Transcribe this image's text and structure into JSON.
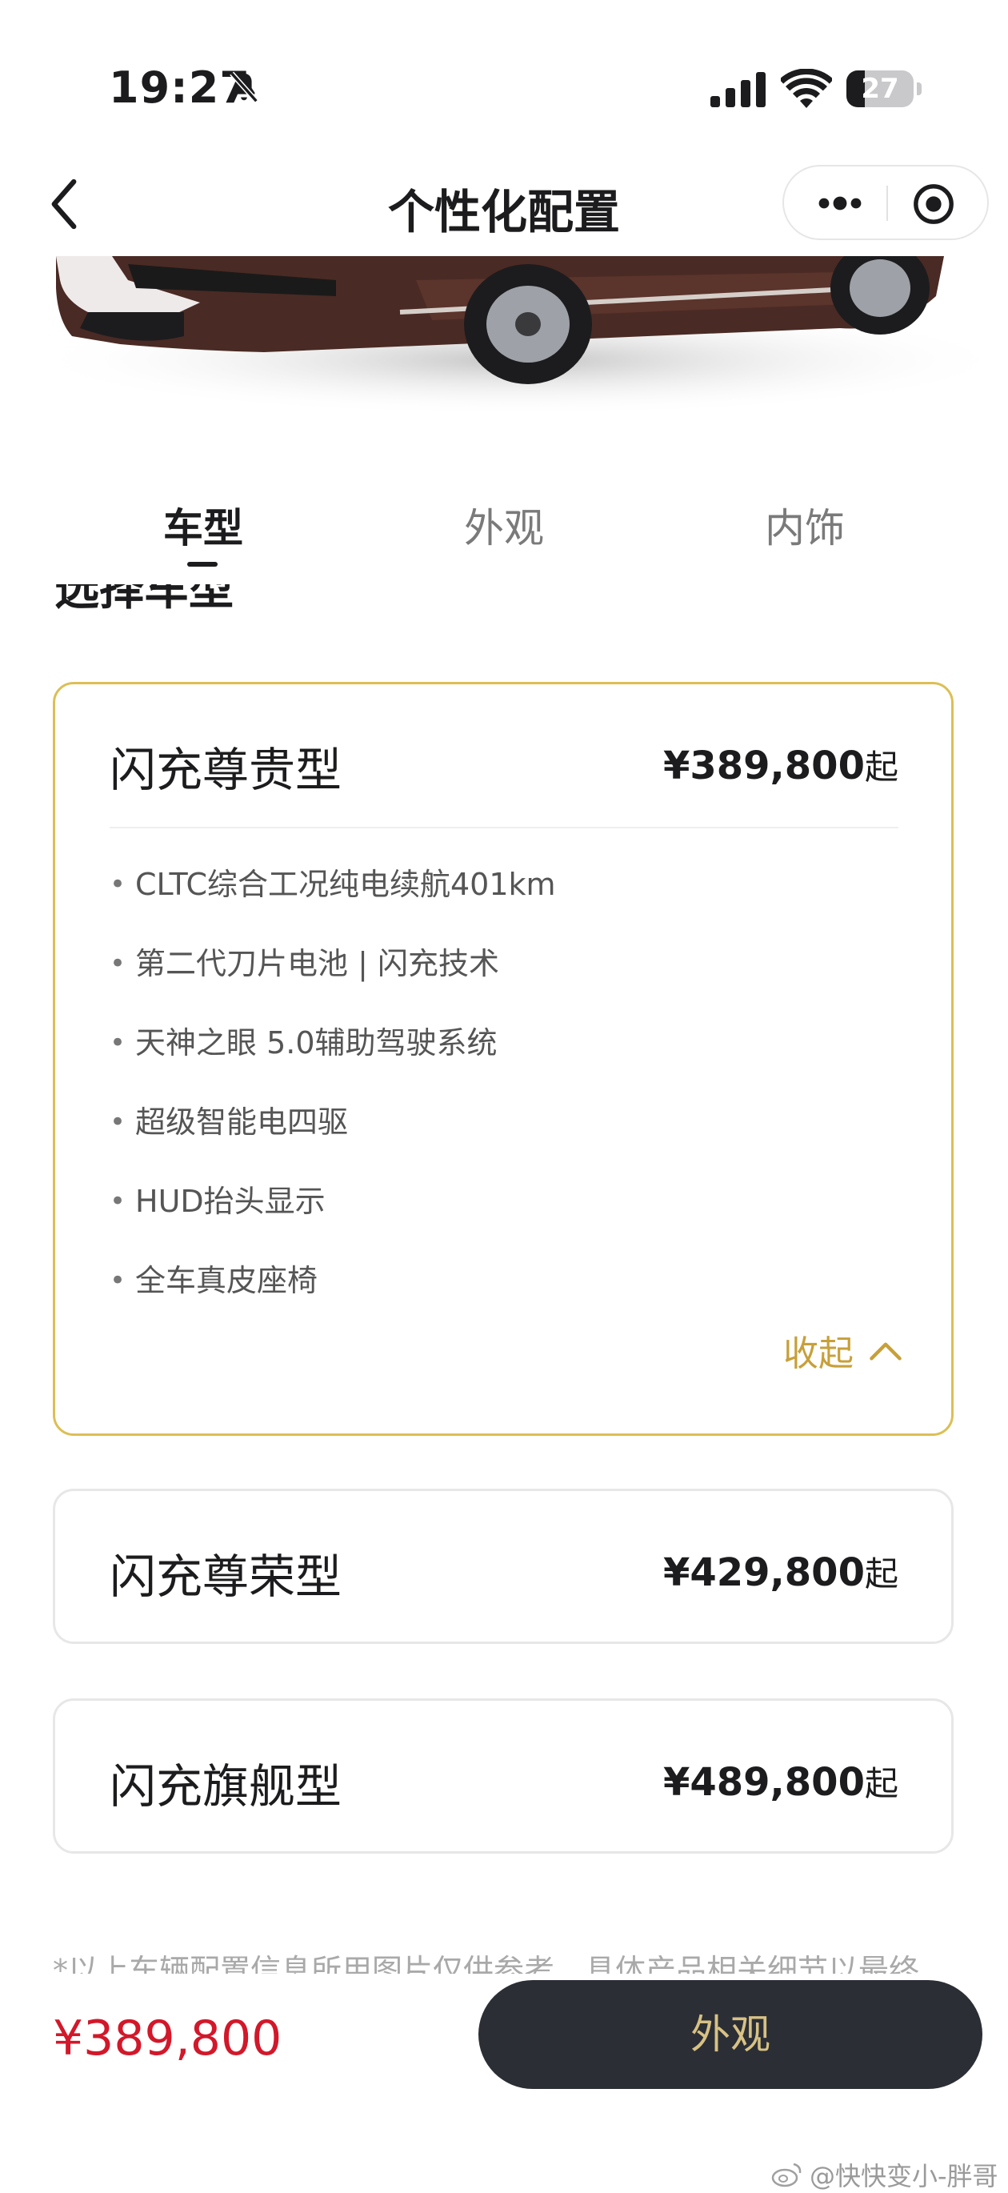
{
  "status_bar": {
    "time": "19:27",
    "battery": "27",
    "battery_level": 0.27
  },
  "nav": {
    "title": "个性化配置"
  },
  "tabs": [
    {
      "label": "车型",
      "active": true
    },
    {
      "label": "外观",
      "active": false
    },
    {
      "label": "内饰",
      "active": false
    }
  ],
  "section_title": "选择车型",
  "trims": [
    {
      "name": "闪充尊贵型",
      "price": "¥389,800",
      "price_suffix": "起",
      "selected": true,
      "features": [
        "CLTC综合工况纯电续航401km",
        "第二代刀片电池 | 闪充技术",
        "天神之眼 5.0辅助驾驶系统",
        "超级智能电四驱",
        "HUD抬头显示",
        "全车真皮座椅"
      ],
      "collapse_label": "收起"
    },
    {
      "name": "闪充尊荣型",
      "price": "¥429,800",
      "price_suffix": "起",
      "selected": false
    },
    {
      "name": "闪充旗舰型",
      "price": "¥489,800",
      "price_suffix": "起",
      "selected": false
    }
  ],
  "disclaimer": "*以上车辆配置信息所用图片仅供参考，具体产品相关细节以最终",
  "bottom_bar": {
    "total_price": "¥389,800",
    "next_button": "外观"
  },
  "watermark": "@快快变小-胖哥",
  "colors": {
    "accent_gold": "#dcbf55",
    "price_red": "#d2182a",
    "button_dark": "#2b2e35",
    "button_text": "#d7c184"
  }
}
